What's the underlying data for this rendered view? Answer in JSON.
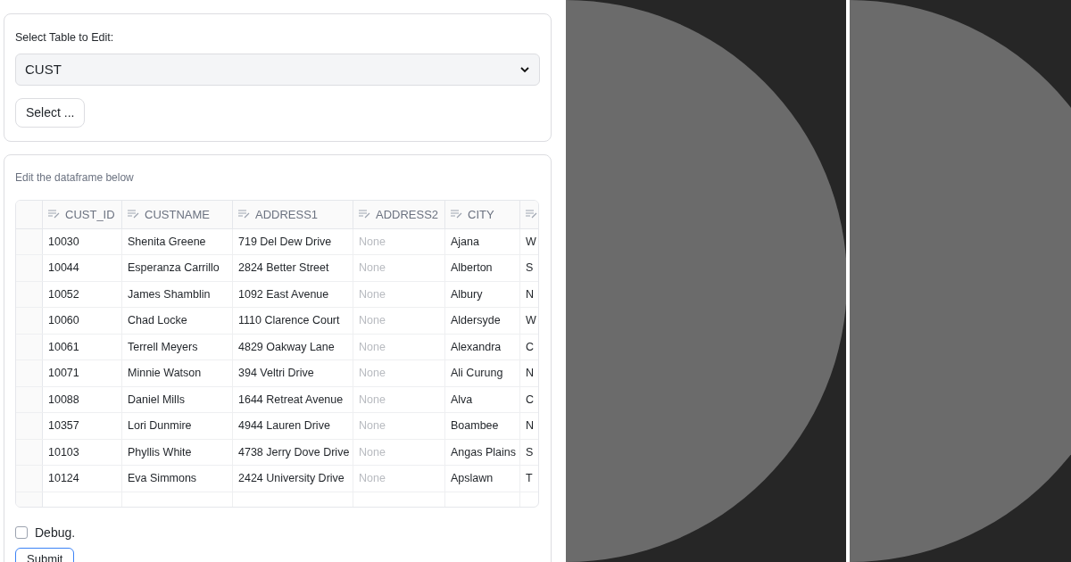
{
  "table_picker": {
    "label": "Select Table to Edit:",
    "value": "CUST",
    "button": "Select ..."
  },
  "editor": {
    "caption": "Edit the dataframe below",
    "columns": [
      {
        "label": "CUST_ID"
      },
      {
        "label": "CUSTNAME"
      },
      {
        "label": "ADDRESS1"
      },
      {
        "label": "ADDRESS2"
      },
      {
        "label": "CITY"
      },
      {}
    ],
    "rows": [
      {
        "cells": [
          "10030",
          "Shenita Greene",
          "719 Del Dew Drive",
          {
            "text": "None",
            "null": true
          },
          "Ajana",
          "W"
        ]
      },
      {
        "cells": [
          "10044",
          "Esperanza Carrillo",
          "2824 Better Street",
          {
            "text": "None",
            "null": true
          },
          "Alberton",
          "S"
        ]
      },
      {
        "cells": [
          "10052",
          "James Shamblin",
          "1092 East Avenue",
          {
            "text": "None",
            "null": true
          },
          "Albury",
          "N"
        ]
      },
      {
        "cells": [
          "10060",
          "Chad Locke",
          "1110 Clarence Court",
          {
            "text": "None",
            "null": true
          },
          "Aldersyde",
          "W"
        ]
      },
      {
        "cells": [
          "10061",
          "Terrell Meyers",
          "4829 Oakway Lane",
          {
            "text": "None",
            "null": true
          },
          "Alexandra",
          "C"
        ]
      },
      {
        "cells": [
          "10071",
          "Minnie Watson",
          "394 Veltri Drive",
          {
            "text": "None",
            "null": true
          },
          "Ali Curung",
          "N"
        ]
      },
      {
        "cells": [
          "10088",
          "Daniel Mills",
          "1644 Retreat Avenue",
          {
            "text": "None",
            "null": true
          },
          "Alva",
          "C"
        ]
      },
      {
        "cells": [
          "10357",
          "Lori Dunmire",
          "4944 Lauren Drive",
          {
            "text": "None",
            "null": true
          },
          "Boambee",
          "N"
        ]
      },
      {
        "cells": [
          "10103",
          "Phyllis White",
          "4738 Jerry Dove Drive",
          {
            "text": "None",
            "null": true
          },
          "Angas Plains",
          "S"
        ]
      },
      {
        "cells": [
          "10124",
          "Eva Simmons",
          "2424 University Drive",
          {
            "text": "None",
            "null": true
          },
          "Apslawn",
          "T"
        ]
      }
    ],
    "debug": {
      "label": "Debug.",
      "checked": false
    },
    "submit": "Submit"
  }
}
